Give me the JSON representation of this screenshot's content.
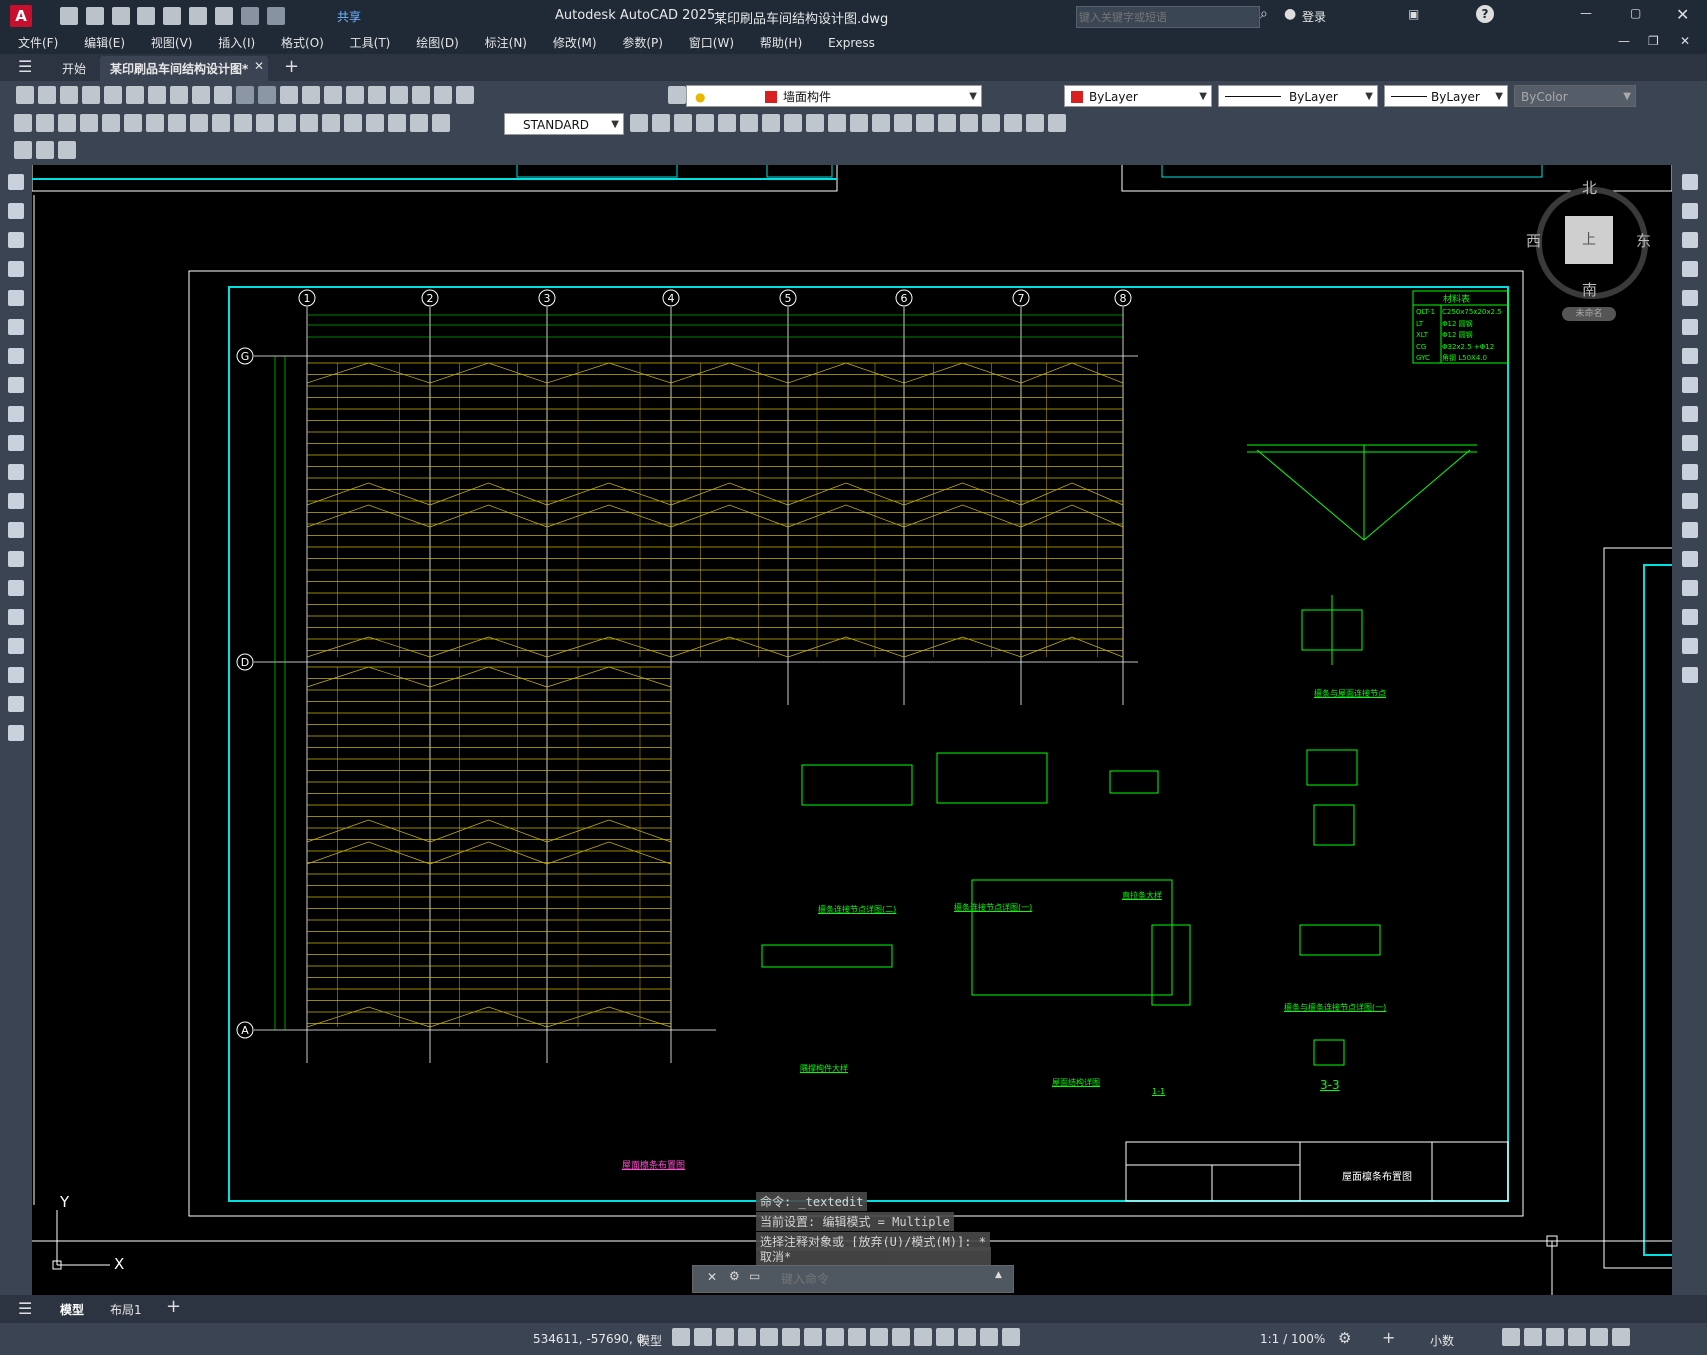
{
  "titlebar": {
    "app_name": "Autodesk AutoCAD 2025",
    "filename": "某印刷品车间结构设计图.dwg",
    "share_label": "共享",
    "search_placeholder": "键入关键字或短语",
    "login_label": "登录"
  },
  "menu": [
    "文件(F)",
    "编辑(E)",
    "视图(V)",
    "插入(I)",
    "格式(O)",
    "工具(T)",
    "绘图(D)",
    "标注(N)",
    "修改(M)",
    "参数(P)",
    "窗口(W)",
    "帮助(H)",
    "Express"
  ],
  "tabs": {
    "start": "开始",
    "active": "某印刷品车间结构设计图*"
  },
  "toolbar": {
    "layer_name": "墙面构件",
    "color": "ByLayer",
    "linetype": "ByLayer",
    "lineweight": "ByLayer",
    "plotstyle": "ByColor",
    "textstyle": "STANDARD"
  },
  "viewcube": {
    "north": "北",
    "south": "南",
    "east": "东",
    "west": "西",
    "top": "上",
    "wcs": "未命名"
  },
  "command": {
    "line1": "命令: _textedit",
    "line2": "当前设置: 编辑模式 = Multiple",
    "line3": "选择注释对象或 [放弃(U)/模式(M)]: *",
    "line4": "取消*",
    "placeholder": "键入命令"
  },
  "drawing": {
    "grid_numbers": [
      "1",
      "2",
      "3",
      "4",
      "5",
      "6",
      "7",
      "8"
    ],
    "grid_letters": [
      "G",
      "D",
      "A"
    ],
    "main_title": "屋面檩条布置图",
    "table_title": "材料表",
    "materials": [
      [
        "QLT-1",
        "C250x75x20x2.5"
      ],
      [
        "LT",
        "Φ12 圆钢"
      ],
      [
        "XLT",
        "Φ12 圆钢"
      ],
      [
        "CG",
        "Φ32x2.5 +Φ12"
      ],
      [
        "GYC",
        "角钢 L50X4.0"
      ]
    ],
    "detail_titles": [
      "檩条连接节点详图(二)",
      "檩条连接节点详图(一)",
      "直拉条大样",
      "隅撑构件大样",
      "屋面结构详图",
      "檩条与屋面连接节点",
      "檩条与檩条连接节点详图(一)",
      "3-3",
      "1-1"
    ],
    "titleblock_name": "屋面檩条布置图",
    "axis_x": "X",
    "axis_y": "Y"
  },
  "layout_tabs": [
    "模型",
    "布局1"
  ],
  "status": {
    "coords": "534611, -57690, 0",
    "model": "模型",
    "scale": "1:1 / 100%",
    "units": "小数"
  },
  "colors": {
    "frame": "#00e0e0",
    "grid_line": "#ffffff",
    "purlin": "#c8b400",
    "dimension": "#00ff00",
    "accent_red": "#d82020"
  }
}
